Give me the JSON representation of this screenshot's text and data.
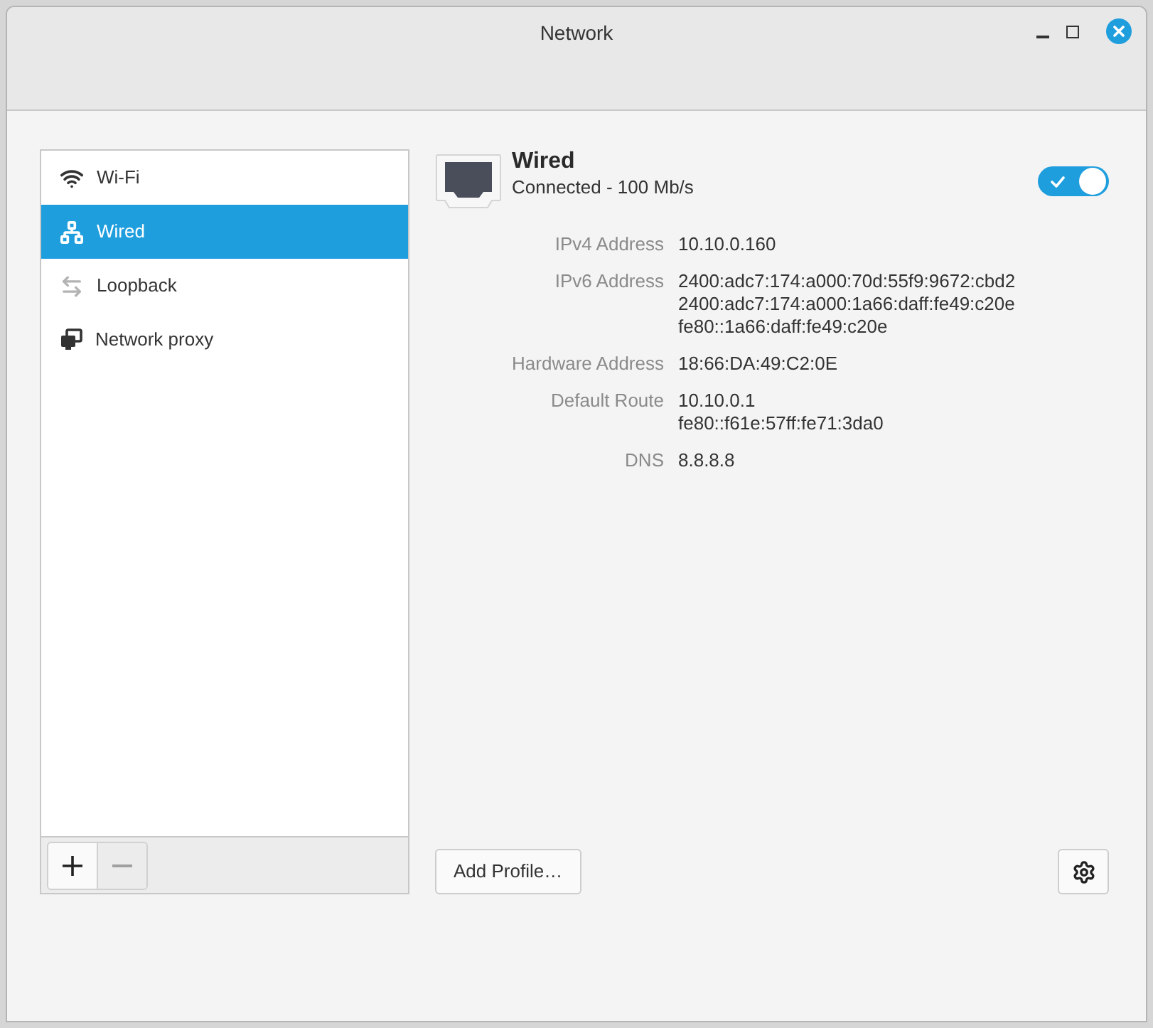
{
  "window": {
    "title": "Network"
  },
  "sidebar": {
    "items": [
      {
        "label": "Wi-Fi",
        "kind": "wifi",
        "selected": false
      },
      {
        "label": "Wired",
        "kind": "wired",
        "selected": true
      },
      {
        "label": "Loopback",
        "kind": "loopback",
        "selected": false
      },
      {
        "label": "Network proxy",
        "kind": "proxy",
        "selected": false
      }
    ],
    "add_button": {
      "disabled": false
    },
    "remove_button": {
      "disabled": true
    }
  },
  "connection": {
    "name": "Wired",
    "status": "Connected - 100 Mb/s",
    "enabled": true,
    "details": [
      {
        "label": "IPv4 Address",
        "values": [
          "10.10.0.160"
        ]
      },
      {
        "label": "IPv6 Address",
        "values": [
          "2400:adc7:174:a000:70d:55f9:9672:cbd2",
          "2400:adc7:174:a000:1a66:daff:fe49:c20e",
          "fe80::1a66:daff:fe49:c20e"
        ]
      },
      {
        "label": "Hardware Address",
        "values": [
          "18:66:DA:49:C2:0E"
        ]
      },
      {
        "label": "Default Route",
        "values": [
          "10.10.0.1",
          "fe80::f61e:57ff:fe71:3da0"
        ]
      },
      {
        "label": "DNS",
        "values": [
          "8.8.8.8"
        ]
      }
    ]
  },
  "buttons": {
    "add_profile": "Add Profile…"
  }
}
